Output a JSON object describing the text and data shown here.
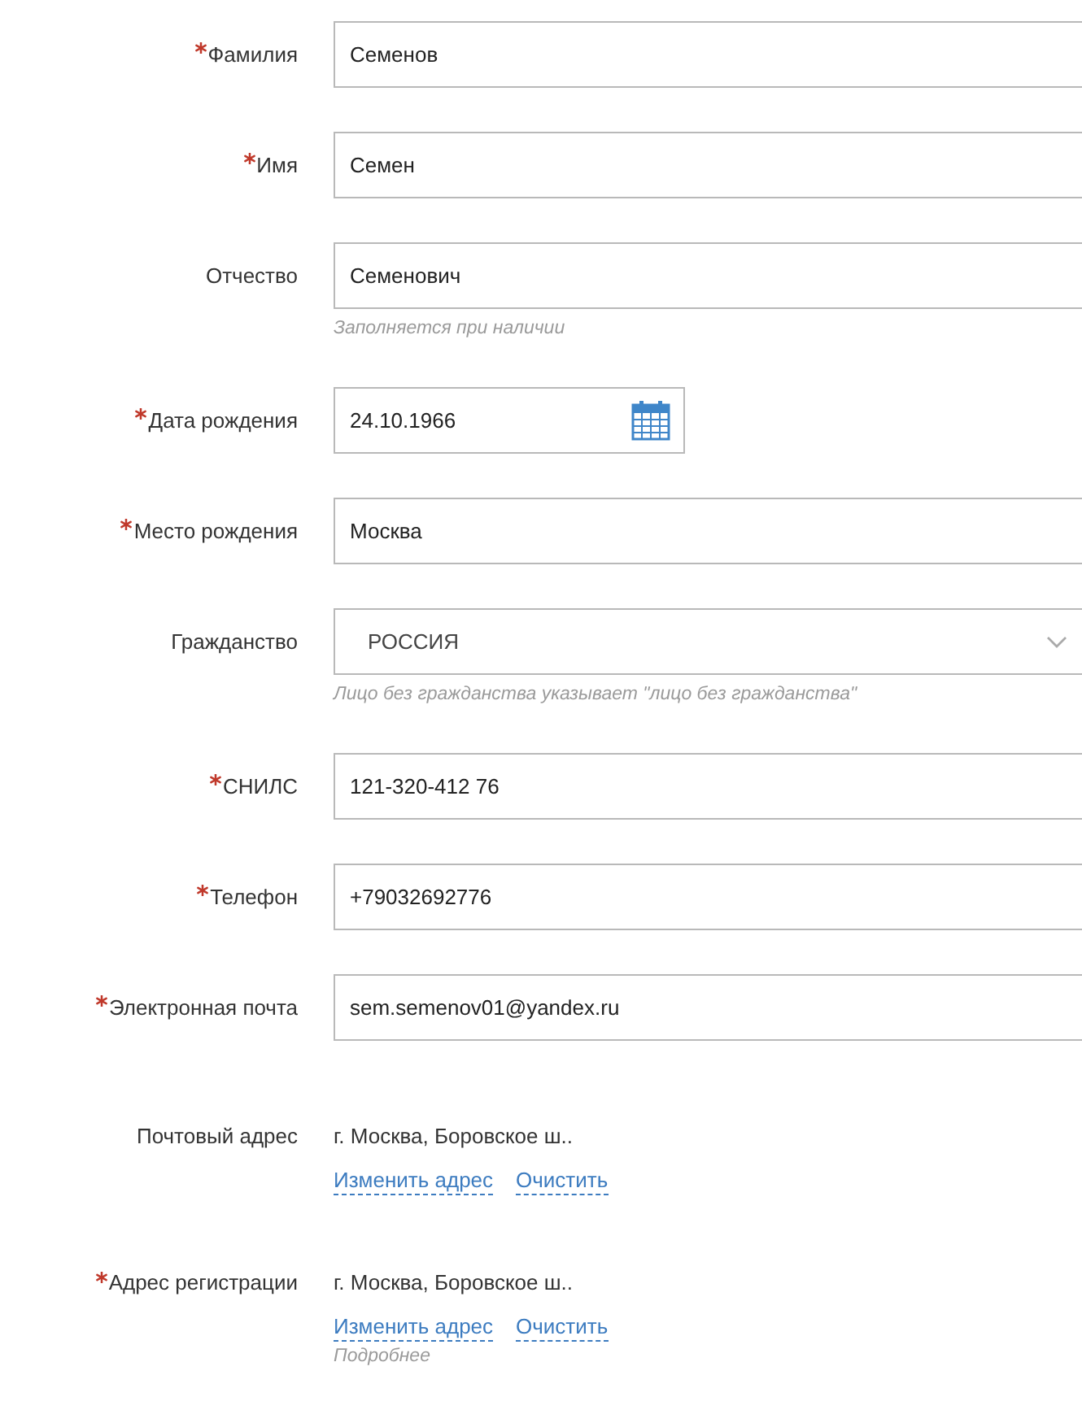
{
  "fields": [
    {
      "kind": "text",
      "label": "Фамилия",
      "required": true,
      "value": "Семенов"
    },
    {
      "kind": "text",
      "label": "Имя",
      "required": true,
      "value": "Семен"
    },
    {
      "kind": "text",
      "label": "Отчество",
      "required": false,
      "value": "Семенович",
      "hint": "Заполняется при наличии"
    },
    {
      "kind": "date",
      "label": "Дата рождения",
      "required": true,
      "value": "24.10.1966"
    },
    {
      "kind": "text",
      "label": "Место рождения",
      "required": true,
      "value": "Москва"
    },
    {
      "kind": "select",
      "label": "Гражданство",
      "required": false,
      "value": "РОССИЯ",
      "hint": "Лицо без гражданства указывает \"лицо без гражданства\""
    },
    {
      "kind": "text",
      "label": "СНИЛС",
      "required": true,
      "value": "121-320-412 76"
    },
    {
      "kind": "text",
      "label": "Телефон",
      "required": true,
      "value": "+79032692776"
    },
    {
      "kind": "text",
      "label": "Электронная почта",
      "required": true,
      "value": "sem.semenov01@yandex.ru"
    },
    {
      "kind": "address",
      "label": "Почтовый адрес",
      "required": false,
      "value": "г. Москва, Боровское ш..",
      "links": [
        "Изменить адрес",
        "Очистить"
      ]
    },
    {
      "kind": "address",
      "label": "Адрес регистрации",
      "required": true,
      "value": "г. Москва, Боровское ш..",
      "links": [
        "Изменить адрес",
        "Очистить"
      ],
      "hint": "Подробнее"
    }
  ]
}
